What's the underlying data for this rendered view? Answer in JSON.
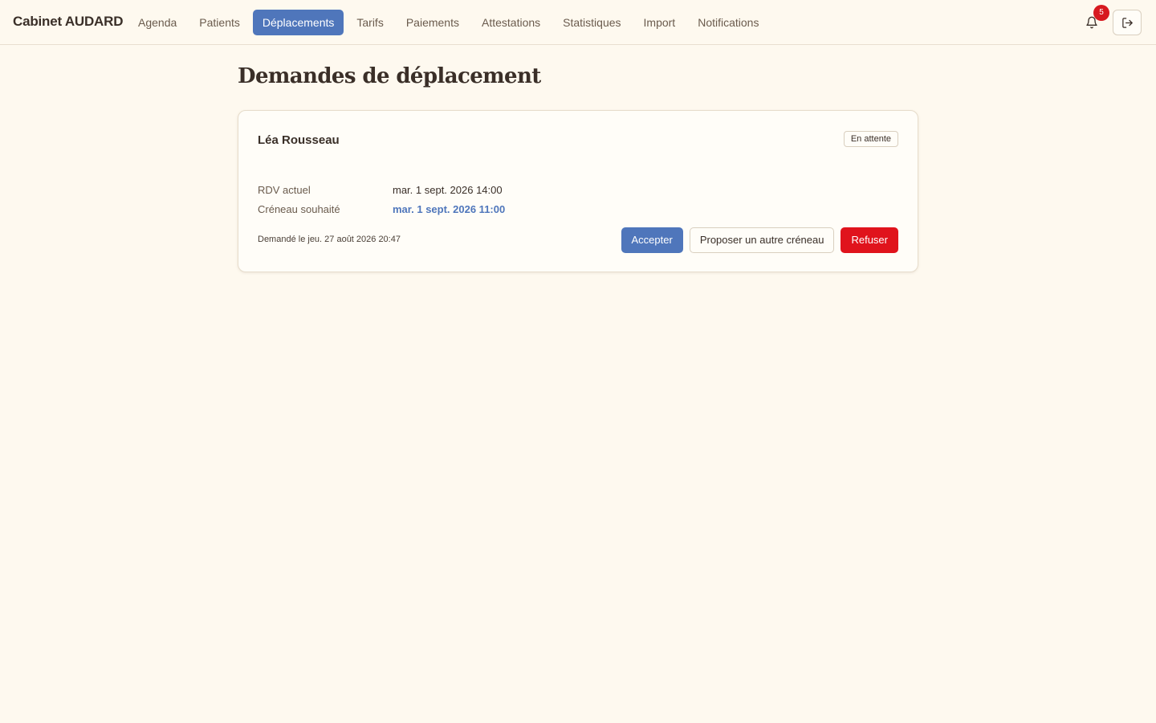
{
  "app": {
    "brand": "Cabinet AUDARD"
  },
  "nav": {
    "items": [
      {
        "label": "Agenda"
      },
      {
        "label": "Patients"
      },
      {
        "label": "Déplacements"
      },
      {
        "label": "Tarifs"
      },
      {
        "label": "Paiements"
      },
      {
        "label": "Attestations"
      },
      {
        "label": "Statistiques"
      },
      {
        "label": "Import"
      },
      {
        "label": "Notifications"
      }
    ],
    "active": "Déplacements"
  },
  "header": {
    "notifications_count": "5",
    "bell_icon": "bell-icon",
    "logout_icon": "logout-icon"
  },
  "page": {
    "title": "Demandes de déplacement"
  },
  "request": {
    "patient_name": "Léa Rousseau",
    "status": "En attente",
    "current_label": "RDV actuel",
    "current_value": "mar. 1 sept. 2026 14:00",
    "wished_label": "Créneau souhaité",
    "wished_value": "mar. 1 sept. 2026 11:00",
    "requested_at": "Demandé le jeu. 27 août 2026 20:47",
    "actions": {
      "accept": "Accepter",
      "propose": "Proposer un autre créneau",
      "refuse": "Refuser"
    }
  },
  "colors": {
    "background": "#fef9ef",
    "accent": "#4f76bb",
    "danger": "#e0131c",
    "badge": "#d7191f"
  }
}
